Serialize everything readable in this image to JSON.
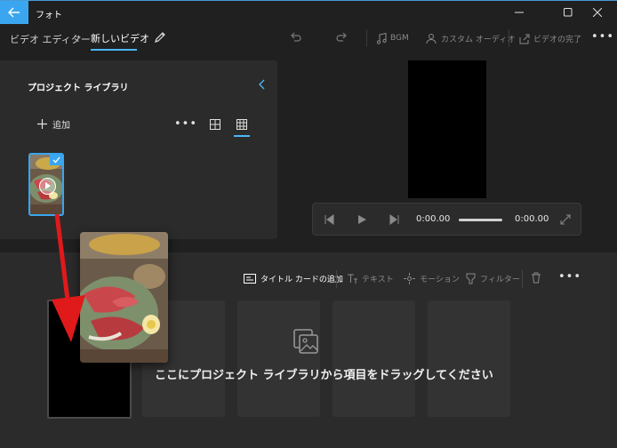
{
  "app": {
    "title": "フォト"
  },
  "breadcrumb": {
    "parent": "ビデオ エディター",
    "separator": "›",
    "current": "新しいビデオ"
  },
  "toolbar": {
    "bgm": "BGM",
    "custom_audio": "カスタム オーディオ",
    "finish": "ビデオの完了"
  },
  "library": {
    "title": "プロジェクト ライブラリ",
    "add_label": "追加",
    "more": "•••"
  },
  "player": {
    "current_time": "0:00.00",
    "total_time": "0:00.00",
    "progress": 0
  },
  "storyboard": {
    "title_card": "タイトル カードの追加",
    "text": "テキスト",
    "motion": "モーション",
    "filter": "フィルター",
    "more": "•••",
    "drop_hint": "ここにプロジェクト ライブラリから項目をドラッグしてください"
  },
  "colors": {
    "accent": "#3aa6ef",
    "background": "#202020",
    "panel": "#2b2b2b",
    "arrow": "#e0191b"
  },
  "icons": [
    "back-arrow-icon",
    "minimize-icon",
    "maximize-icon",
    "close-icon",
    "pencil-icon",
    "undo-icon",
    "redo-icon",
    "music-note-icon",
    "person-audio-icon",
    "share-icon",
    "more-icon",
    "chevron-left-icon",
    "plus-icon",
    "grid-large-icon",
    "grid-small-icon",
    "check-icon",
    "play-icon",
    "prev-frame-icon",
    "next-frame-icon",
    "expand-icon",
    "title-card-icon",
    "text-icon",
    "motion-icon",
    "filter-icon",
    "delete-icon",
    "image-stack-icon",
    "drag-arrow-icon"
  ]
}
